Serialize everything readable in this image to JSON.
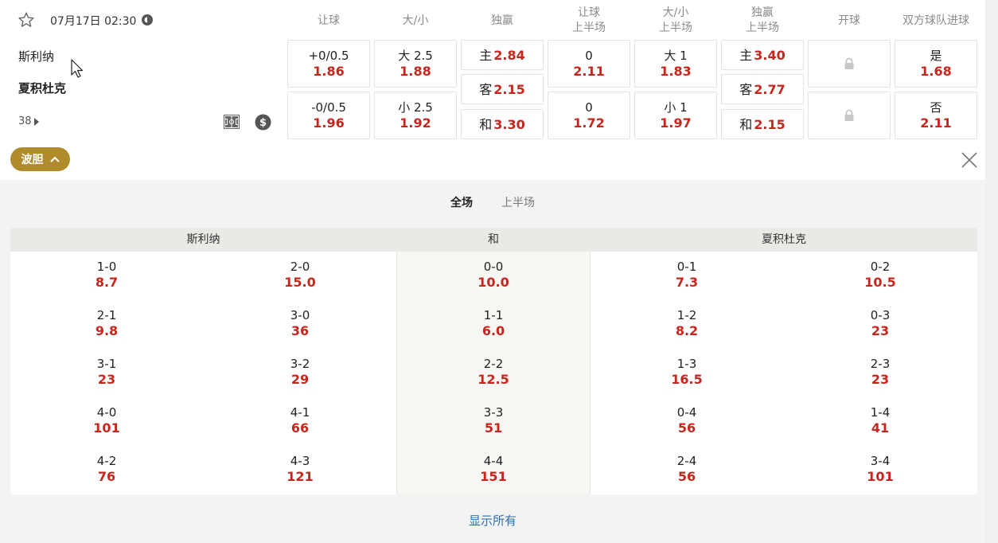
{
  "match": {
    "datetime": "07月17日 02:30",
    "home_team": "斯利纳",
    "away_team": "夏积杜克",
    "more_markets_count": "38"
  },
  "columns": {
    "handicap": "让球",
    "over_under": "大/小",
    "moneyline": "独赢",
    "handicap_1h_a": "让球",
    "handicap_1h_b": "上半场",
    "ou_1h_a": "大/小",
    "ou_1h_b": "上半场",
    "ml_1h_a": "独赢",
    "ml_1h_b": "上半场",
    "kickoff": "开球",
    "btts": "双方球队进球"
  },
  "odds": {
    "handicap": [
      {
        "label": "+0/0.5",
        "odd": "1.86"
      },
      {
        "label": "-0/0.5",
        "odd": "1.96"
      }
    ],
    "over_under": [
      {
        "label": "大 2.5",
        "odd": "1.88"
      },
      {
        "label": "小 2.5",
        "odd": "1.92"
      }
    ],
    "moneyline": [
      {
        "label": "主",
        "odd": "2.84"
      },
      {
        "label": "客",
        "odd": "2.15"
      },
      {
        "label": "和",
        "odd": "3.30"
      }
    ],
    "handicap_1h": [
      {
        "label": "0",
        "odd": "2.11"
      },
      {
        "label": "0",
        "odd": "1.72"
      }
    ],
    "ou_1h": [
      {
        "label": "大 1",
        "odd": "1.83"
      },
      {
        "label": "小 1",
        "odd": "1.97"
      }
    ],
    "ml_1h": [
      {
        "label": "主",
        "odd": "3.40"
      },
      {
        "label": "客",
        "odd": "2.77"
      },
      {
        "label": "和",
        "odd": "2.15"
      }
    ],
    "btts": [
      {
        "label": "是",
        "odd": "1.68"
      },
      {
        "label": "否",
        "odd": "2.11"
      }
    ]
  },
  "correct_score": {
    "tab_label": "波胆",
    "periods": [
      "全场",
      "上半场"
    ],
    "headers": {
      "home": "斯利纳",
      "draw": "和",
      "away": "夏积杜克"
    },
    "rows": [
      [
        {
          "s": "1-0",
          "o": "8.7"
        },
        {
          "s": "2-0",
          "o": "15.0"
        },
        {
          "s": "0-0",
          "o": "10.0"
        },
        {
          "s": "0-1",
          "o": "7.3"
        },
        {
          "s": "0-2",
          "o": "10.5"
        }
      ],
      [
        {
          "s": "2-1",
          "o": "9.8"
        },
        {
          "s": "3-0",
          "o": "36"
        },
        {
          "s": "1-1",
          "o": "6.0"
        },
        {
          "s": "1-2",
          "o": "8.2"
        },
        {
          "s": "0-3",
          "o": "23"
        }
      ],
      [
        {
          "s": "3-1",
          "o": "23"
        },
        {
          "s": "3-2",
          "o": "29"
        },
        {
          "s": "2-2",
          "o": "12.5"
        },
        {
          "s": "1-3",
          "o": "16.5"
        },
        {
          "s": "2-3",
          "o": "23"
        }
      ],
      [
        {
          "s": "4-0",
          "o": "101"
        },
        {
          "s": "4-1",
          "o": "66"
        },
        {
          "s": "3-3",
          "o": "51"
        },
        {
          "s": "0-4",
          "o": "56"
        },
        {
          "s": "1-4",
          "o": "41"
        }
      ],
      [
        {
          "s": "4-2",
          "o": "76"
        },
        {
          "s": "4-3",
          "o": "121"
        },
        {
          "s": "4-4",
          "o": "151"
        },
        {
          "s": "2-4",
          "o": "56"
        },
        {
          "s": "3-4",
          "o": "101"
        }
      ]
    ],
    "show_all": "显示所有"
  },
  "colors": {
    "odd": "#c8261c",
    "accent": "#b08b2a",
    "link": "#2a6fb3"
  },
  "icons": [
    "star-icon",
    "live-icon",
    "pitch-icon",
    "dollar-icon",
    "lock-icon",
    "chevron-up-icon",
    "close-icon",
    "cursor-icon",
    "triangle-right-icon"
  ]
}
